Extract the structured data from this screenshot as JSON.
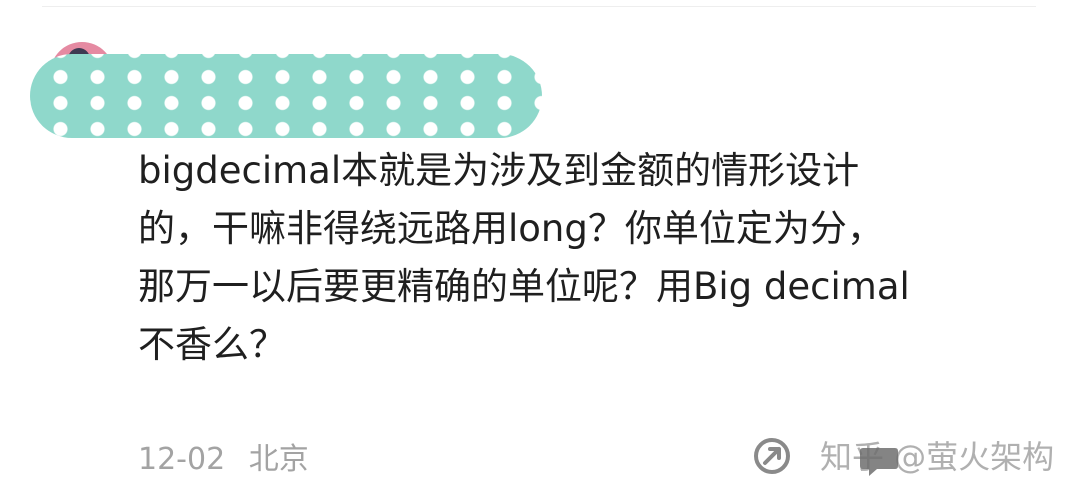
{
  "comment": {
    "lines": [
      "bigdecimal本就是为涉及到金额的情形设计",
      "的，干嘛非得绕远路用long？你单位定为分，",
      "那万一以后要更精确的单位呢？用Big decimal",
      "不香么？"
    ]
  },
  "meta": {
    "date": "12-02",
    "location": "北京"
  },
  "watermark": {
    "text": "知乎 @萤火架构"
  },
  "icons": {
    "share": "share-icon",
    "reply": "comment-reply-icon"
  },
  "colors": {
    "avatar": "#e58aa2",
    "redaction": "#8fd8cb",
    "meta_text": "#a3a3a3"
  }
}
